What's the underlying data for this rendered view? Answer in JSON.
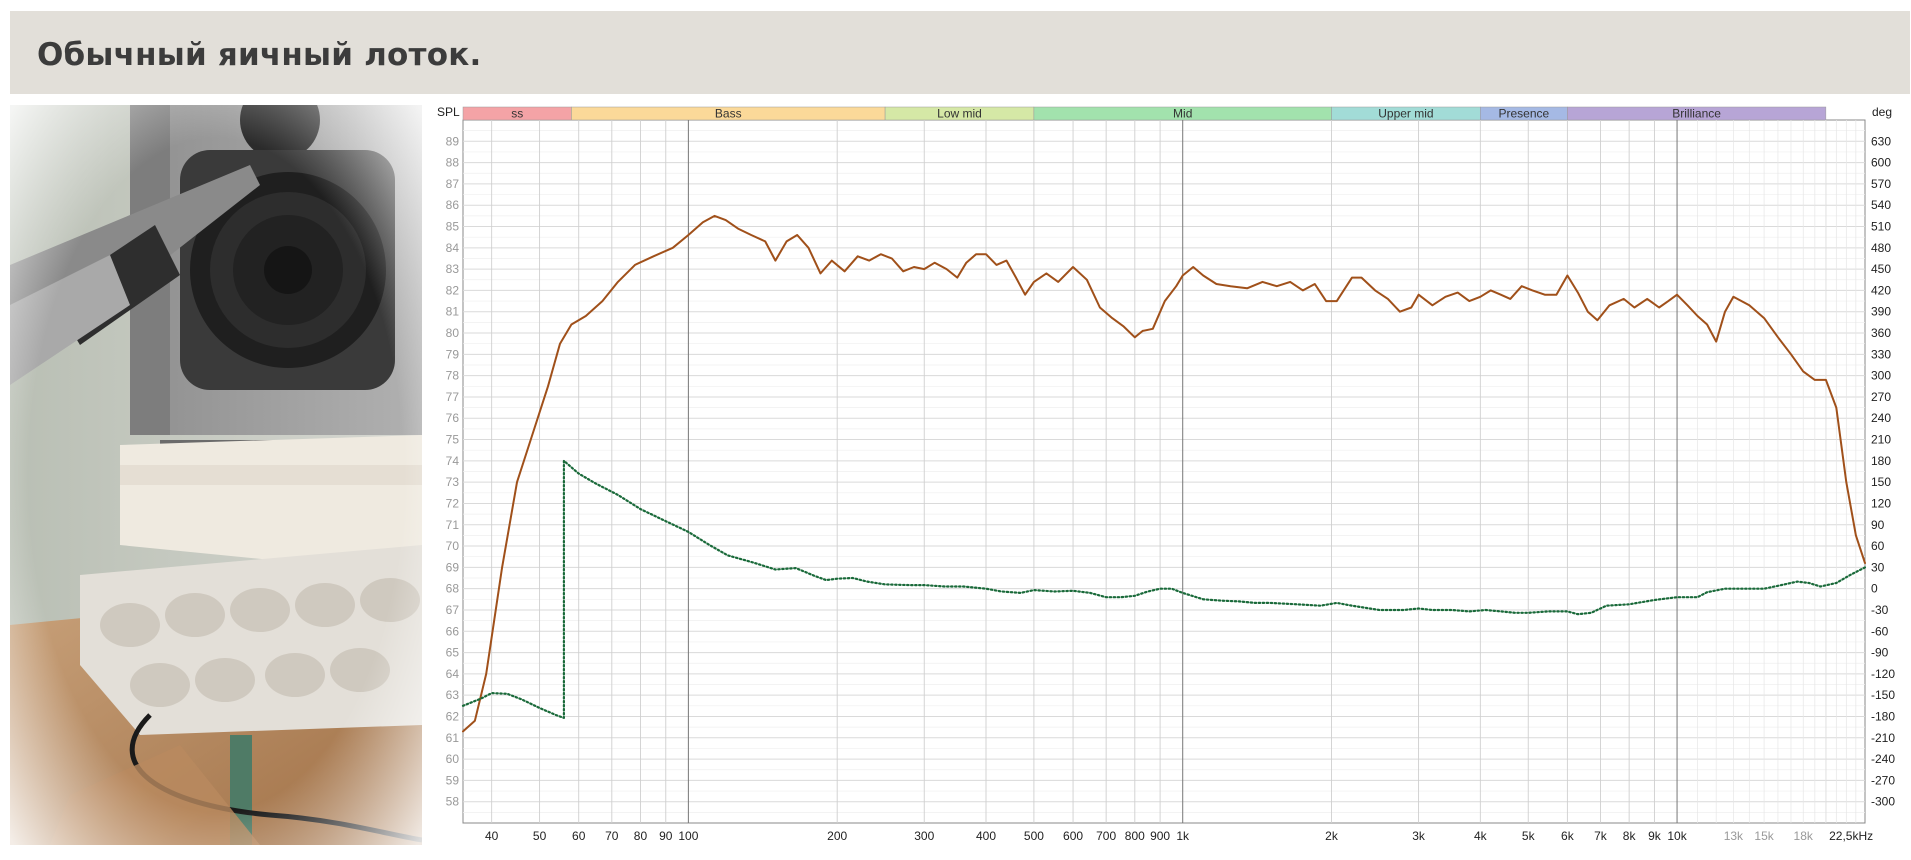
{
  "header": {
    "title": "Обычный яичный лоток."
  },
  "photo": {
    "label": "speaker measurement photo"
  },
  "chart_data": {
    "type": "line",
    "left_axis_title": "SPL",
    "right_axis_title": "deg",
    "x_scale": "log",
    "x_range_hz": [
      35,
      24000
    ],
    "y_left_range": [
      57,
      90
    ],
    "y_right_range": [
      -330,
      660
    ],
    "y_left_ticks": [
      "58",
      "59",
      "60",
      "61",
      "62",
      "63",
      "64",
      "65",
      "66",
      "67",
      "68",
      "69",
      "70",
      "71",
      "72",
      "73",
      "74",
      "75",
      "76",
      "77",
      "78",
      "79",
      "80",
      "81",
      "82",
      "83",
      "84",
      "85",
      "86",
      "87",
      "88",
      "89"
    ],
    "y_right_ticks": [
      "-300",
      "-270",
      "-240",
      "-210",
      "-180",
      "-150",
      "-120",
      "-90",
      "-60",
      "-30",
      "0",
      "30",
      "60",
      "90",
      "120",
      "150",
      "180",
      "210",
      "240",
      "270",
      "300",
      "330",
      "360",
      "390",
      "420",
      "450",
      "480",
      "510",
      "540",
      "570",
      "600",
      "630"
    ],
    "x_ticks": [
      "40",
      "50",
      "60",
      "70",
      "80",
      "90",
      "100",
      "200",
      "300",
      "400",
      "500",
      "600",
      "700",
      "800",
      "900",
      "1k",
      "2k",
      "3k",
      "4k",
      "5k",
      "6k",
      "7k",
      "8k",
      "9k",
      "10k",
      "13k",
      "15k",
      "18k",
      "22,5kHz"
    ],
    "bands": [
      {
        "label": "ss",
        "from": 35,
        "to": 58,
        "color": "#f4a3a6"
      },
      {
        "label": "Bass",
        "from": 58,
        "to": 250,
        "color": "#fbd999"
      },
      {
        "label": "Low mid",
        "from": 250,
        "to": 500,
        "color": "#d5e8a6"
      },
      {
        "label": "Mid",
        "from": 500,
        "to": 2000,
        "color": "#a2e2ad"
      },
      {
        "label": "Upper mid",
        "from": 2000,
        "to": 4000,
        "color": "#a2dcd7"
      },
      {
        "label": "Presence",
        "from": 4000,
        "to": 6000,
        "color": "#a5b9e4"
      },
      {
        "label": "Brilliance",
        "from": 6000,
        "to": 20000,
        "color": "#b7a5d6"
      }
    ],
    "series": [
      {
        "axis": "left",
        "color": "#a0501a",
        "style": "solid",
        "points": [
          [
            35,
            61.3
          ],
          [
            37,
            61.8
          ],
          [
            39,
            64
          ],
          [
            42,
            69
          ],
          [
            45,
            73
          ],
          [
            48,
            75
          ],
          [
            52,
            77.5
          ],
          [
            55,
            79.5
          ],
          [
            58,
            80.4
          ],
          [
            62,
            80.8
          ],
          [
            67,
            81.5
          ],
          [
            72,
            82.4
          ],
          [
            78,
            83.2
          ],
          [
            85,
            83.6
          ],
          [
            93,
            84
          ],
          [
            100,
            84.6
          ],
          [
            107,
            85.2
          ],
          [
            113,
            85.5
          ],
          [
            119,
            85.3
          ],
          [
            126,
            84.9
          ],
          [
            134,
            84.6
          ],
          [
            143,
            84.3
          ],
          [
            150,
            83.4
          ],
          [
            158,
            84.3
          ],
          [
            166,
            84.6
          ],
          [
            175,
            84
          ],
          [
            185,
            82.8
          ],
          [
            195,
            83.4
          ],
          [
            207,
            82.9
          ],
          [
            220,
            83.6
          ],
          [
            232,
            83.4
          ],
          [
            245,
            83.7
          ],
          [
            258,
            83.5
          ],
          [
            272,
            82.9
          ],
          [
            286,
            83.1
          ],
          [
            300,
            83
          ],
          [
            315,
            83.3
          ],
          [
            333,
            83
          ],
          [
            350,
            82.6
          ],
          [
            365,
            83.3
          ],
          [
            382,
            83.7
          ],
          [
            400,
            83.7
          ],
          [
            420,
            83.2
          ],
          [
            440,
            83.4
          ],
          [
            460,
            82.6
          ],
          [
            480,
            81.8
          ],
          [
            500,
            82.4
          ],
          [
            530,
            82.8
          ],
          [
            560,
            82.4
          ],
          [
            600,
            83.1
          ],
          [
            640,
            82.5
          ],
          [
            680,
            81.2
          ],
          [
            720,
            80.7
          ],
          [
            760,
            80.3
          ],
          [
            800,
            79.8
          ],
          [
            830,
            80.1
          ],
          [
            870,
            80.2
          ],
          [
            920,
            81.5
          ],
          [
            970,
            82.2
          ],
          [
            1000,
            82.7
          ],
          [
            1050,
            83.1
          ],
          [
            1100,
            82.7
          ],
          [
            1170,
            82.3
          ],
          [
            1250,
            82.2
          ],
          [
            1350,
            82.1
          ],
          [
            1450,
            82.4
          ],
          [
            1550,
            82.2
          ],
          [
            1650,
            82.4
          ],
          [
            1750,
            82
          ],
          [
            1850,
            82.3
          ],
          [
            1950,
            81.5
          ],
          [
            2050,
            81.5
          ],
          [
            2200,
            82.6
          ],
          [
            2300,
            82.6
          ],
          [
            2450,
            82
          ],
          [
            2600,
            81.6
          ],
          [
            2750,
            81
          ],
          [
            2900,
            81.2
          ],
          [
            3000,
            81.8
          ],
          [
            3200,
            81.3
          ],
          [
            3400,
            81.7
          ],
          [
            3600,
            81.9
          ],
          [
            3800,
            81.5
          ],
          [
            4000,
            81.7
          ],
          [
            4200,
            82
          ],
          [
            4400,
            81.8
          ],
          [
            4600,
            81.6
          ],
          [
            4850,
            82.2
          ],
          [
            5100,
            82
          ],
          [
            5400,
            81.8
          ],
          [
            5700,
            81.8
          ],
          [
            6000,
            82.7
          ],
          [
            6300,
            81.9
          ],
          [
            6600,
            81
          ],
          [
            6900,
            80.6
          ],
          [
            7300,
            81.3
          ],
          [
            7800,
            81.6
          ],
          [
            8200,
            81.2
          ],
          [
            8700,
            81.6
          ],
          [
            9200,
            81.2
          ],
          [
            9600,
            81.5
          ],
          [
            10000,
            81.8
          ],
          [
            10500,
            81.3
          ],
          [
            11000,
            80.8
          ],
          [
            11500,
            80.4
          ],
          [
            12000,
            79.6
          ],
          [
            12500,
            81
          ],
          [
            13000,
            81.7
          ],
          [
            14000,
            81.3
          ],
          [
            15000,
            80.7
          ],
          [
            16000,
            79.8
          ],
          [
            17000,
            79
          ],
          [
            18000,
            78.2
          ],
          [
            19000,
            77.8
          ],
          [
            20000,
            77.8
          ],
          [
            21000,
            76.5
          ],
          [
            22000,
            73
          ],
          [
            23000,
            70.5
          ],
          [
            24000,
            69.2
          ]
        ]
      },
      {
        "axis": "right",
        "color": "#1a6a3a",
        "style": "dotted",
        "points": [
          [
            35,
            -165
          ],
          [
            38,
            -155
          ],
          [
            40,
            -147
          ],
          [
            43,
            -148
          ],
          [
            46,
            -156
          ],
          [
            50,
            -168
          ],
          [
            54,
            -178
          ],
          [
            56,
            -182
          ],
          [
            56.01,
            180
          ],
          [
            60,
            162
          ],
          [
            65,
            148
          ],
          [
            72,
            132
          ],
          [
            80,
            112
          ],
          [
            90,
            95
          ],
          [
            100,
            80
          ],
          [
            110,
            62
          ],
          [
            120,
            47
          ],
          [
            135,
            37
          ],
          [
            150,
            27
          ],
          [
            165,
            29
          ],
          [
            180,
            18
          ],
          [
            190,
            12
          ],
          [
            200,
            14
          ],
          [
            215,
            15
          ],
          [
            230,
            10
          ],
          [
            250,
            6
          ],
          [
            280,
            5
          ],
          [
            300,
            5
          ],
          [
            330,
            3
          ],
          [
            360,
            3
          ],
          [
            400,
            0
          ],
          [
            430,
            -4
          ],
          [
            470,
            -6
          ],
          [
            500,
            -2
          ],
          [
            550,
            -4
          ],
          [
            600,
            -3
          ],
          [
            650,
            -6
          ],
          [
            700,
            -12
          ],
          [
            750,
            -12
          ],
          [
            800,
            -10
          ],
          [
            850,
            -4
          ],
          [
            900,
            0
          ],
          [
            950,
            0
          ],
          [
            1000,
            -6
          ],
          [
            1100,
            -15
          ],
          [
            1200,
            -17
          ],
          [
            1300,
            -18
          ],
          [
            1400,
            -20
          ],
          [
            1500,
            -20
          ],
          [
            1700,
            -22
          ],
          [
            1900,
            -24
          ],
          [
            2050,
            -20
          ],
          [
            2200,
            -24
          ],
          [
            2500,
            -30
          ],
          [
            2800,
            -30
          ],
          [
            3000,
            -28
          ],
          [
            3200,
            -30
          ],
          [
            3500,
            -30
          ],
          [
            3800,
            -32
          ],
          [
            4100,
            -30
          ],
          [
            4400,
            -32
          ],
          [
            4700,
            -34
          ],
          [
            5000,
            -34
          ],
          [
            5500,
            -32
          ],
          [
            6000,
            -32
          ],
          [
            6300,
            -36
          ],
          [
            6700,
            -34
          ],
          [
            7200,
            -24
          ],
          [
            8000,
            -22
          ],
          [
            9000,
            -16
          ],
          [
            10000,
            -12
          ],
          [
            11000,
            -12
          ],
          [
            11500,
            -5
          ],
          [
            12500,
            0
          ],
          [
            14000,
            0
          ],
          [
            15000,
            0
          ],
          [
            16000,
            4
          ],
          [
            17500,
            10
          ],
          [
            18500,
            8
          ],
          [
            19500,
            3
          ],
          [
            21000,
            8
          ],
          [
            22500,
            20
          ],
          [
            24000,
            30
          ]
        ]
      }
    ]
  }
}
